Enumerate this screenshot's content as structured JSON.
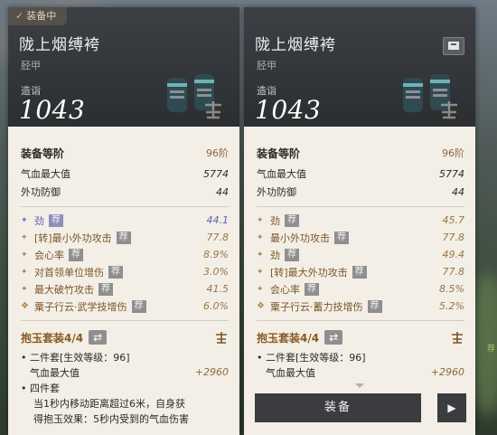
{
  "left": {
    "equipped_label": "装备中",
    "item_name": "陇上烟缚袴",
    "item_type": "胫甲",
    "cap_label": "造诣",
    "cap_value": "1043",
    "tier": {
      "label": "装备等阶",
      "value": "96阶"
    },
    "base": [
      {
        "label": "气血最大值",
        "value": "5774"
      },
      {
        "label": "外功防御",
        "value": "44"
      }
    ],
    "subs": [
      {
        "label": "劲",
        "tag": "荐",
        "value": "44.1",
        "style": "blue"
      },
      {
        "label": "[转]最小外功攻击",
        "tag": "荐",
        "value": "77.8",
        "style": "gold"
      },
      {
        "label": "会心率",
        "tag": "荐",
        "value": "8.9%",
        "style": "gold"
      },
      {
        "label": "对首领单位增伤",
        "tag": "荐",
        "value": "3.0%",
        "style": "gold"
      },
      {
        "label": "最大破竹攻击",
        "tag": "荐",
        "value": "41.5",
        "style": "gold"
      },
      {
        "label": "粟子行云·武学技增伤",
        "tag": "荐",
        "value": "6.0%",
        "style": "diamond"
      }
    ],
    "set_name": "抱玉套装4/4",
    "set_lines": [
      {
        "dot": "•",
        "text": "二件套[生效等级：96]",
        "bonus": ""
      },
      {
        "dot": "",
        "text": "气血最大值",
        "bonus": "+2960"
      },
      {
        "dot": "•",
        "text": "四件套",
        "bonus": ""
      }
    ],
    "desc_1": "当1秒内移动距离超过6米，自身获",
    "desc_2": "得抱玉效果：5秒内受到的气血伤害"
  },
  "right": {
    "item_name": "陇上烟缚袴",
    "item_type": "胫甲",
    "cap_label": "造诣",
    "cap_value": "1043",
    "tier": {
      "label": "装备等阶",
      "value": "96阶"
    },
    "base": [
      {
        "label": "气血最大值",
        "value": "5774"
      },
      {
        "label": "外功防御",
        "value": "44"
      }
    ],
    "subs": [
      {
        "label": "劲",
        "tag": "荐",
        "value": "45.7",
        "style": "gold"
      },
      {
        "label": "最小外功攻击",
        "tag": "荐",
        "value": "77.8",
        "style": "gold"
      },
      {
        "label": "劲",
        "tag": "荐",
        "value": "49.4",
        "style": "gold"
      },
      {
        "label": "[转]最大外功攻击",
        "tag": "荐",
        "value": "77.8",
        "style": "gold"
      },
      {
        "label": "会心率",
        "tag": "荐",
        "value": "8.5%",
        "style": "gold"
      },
      {
        "label": "粟子行云·蓄力技增伤",
        "tag": "荐",
        "value": "5.2%",
        "style": "diamond"
      }
    ],
    "set_name": "抱玉套装4/4",
    "set_lines": [
      {
        "dot": "•",
        "text": "二件套[生效等级：96]",
        "bonus": ""
      },
      {
        "dot": "",
        "text": "气血最大值",
        "bonus": "+2960"
      }
    ],
    "equip_label": "装备",
    "more_label": "▶"
  },
  "colors": {
    "header_bg": "#2b2e31",
    "panel_bg": "#f3efe6",
    "accent_gold": "#8b6a3c",
    "accent_blue": "#5c5fb5"
  },
  "icons": [
    "check-icon",
    "compare-icon",
    "swap-icon",
    "seal-stamp-icon",
    "chevron-up-icon",
    "chevron-down-icon"
  ]
}
